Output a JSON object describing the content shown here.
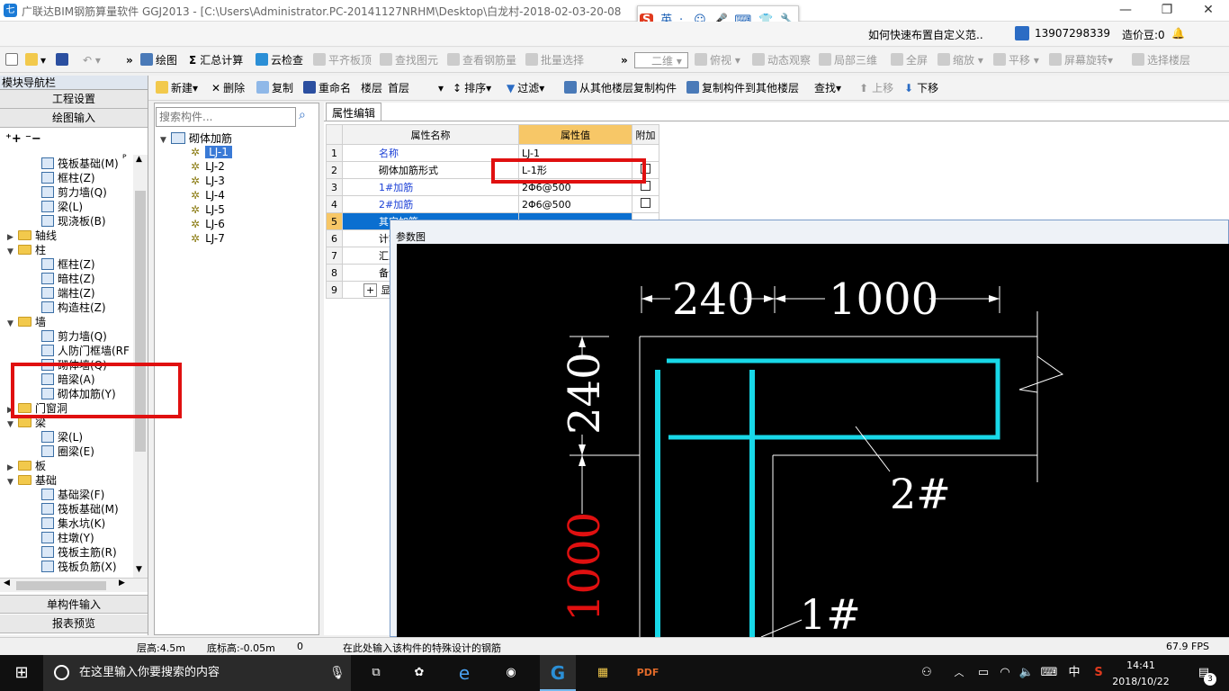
{
  "window": {
    "title": "广联达BIM钢筋算量软件 GGJ2013 - [C:\\Users\\Administrator.PC-20141127NRHM\\Desktop\\白龙村-2018-02-03-20-08",
    "minimize": "—",
    "maximize": "❐",
    "close": "✕"
  },
  "ime": {
    "logo": "S",
    "lang": "英",
    "punct": "·,",
    "items": [
      "☺",
      "🎤",
      "⌨",
      "👕",
      "🔧"
    ]
  },
  "topbar": {
    "question": "如何快速布置自定义范..",
    "phone": "13907298339",
    "price": "造价豆:0"
  },
  "toolbar1": {
    "items": [
      "绘图",
      "汇总计算",
      "云检查",
      "平齐板顶",
      "查找图元",
      "查看钢筋量",
      "批量选择",
      "二维",
      "俯视",
      "动态观察",
      "局部三维",
      "全屏",
      "缩放",
      "平移",
      "屏幕旋转",
      "选择楼层"
    ]
  },
  "toolbar2": {
    "new": "新建",
    "delete": "删除",
    "copy": "复制",
    "rename": "重命名",
    "floor_label": "楼层",
    "floor_value": "首层",
    "sort": "排序",
    "filter": "过滤",
    "copy_from": "从其他楼层复制构件",
    "copy_to": "复制构件到其他楼层",
    "find": "查找",
    "up": "上移",
    "down": "下移"
  },
  "leftpanel": {
    "header": "模块导航栏",
    "pin": "ᴾ",
    "close": "×",
    "engineering": "工程设置",
    "drawing": "绘图输入",
    "single_input": "单构件输入",
    "report": "报表预览",
    "tree": [
      {
        "label": "筏板基础(M)",
        "level": 2
      },
      {
        "label": "框柱(Z)",
        "level": 2
      },
      {
        "label": "剪力墙(Q)",
        "level": 2
      },
      {
        "label": "梁(L)",
        "level": 2
      },
      {
        "label": "现浇板(B)",
        "level": 2
      },
      {
        "label": "轴线",
        "level": 1,
        "exp": "▶"
      },
      {
        "label": "柱",
        "level": 1,
        "exp": "▼"
      },
      {
        "label": "框柱(Z)",
        "level": 2
      },
      {
        "label": "暗柱(Z)",
        "level": 2
      },
      {
        "label": "端柱(Z)",
        "level": 2
      },
      {
        "label": "构造柱(Z)",
        "level": 2
      },
      {
        "label": "墙",
        "level": 1,
        "exp": "▼"
      },
      {
        "label": "剪力墙(Q)",
        "level": 2
      },
      {
        "label": "人防门框墙(RF",
        "level": 2
      },
      {
        "label": "砌体墙(Q)",
        "level": 2
      },
      {
        "label": "暗梁(A)",
        "level": 2
      },
      {
        "label": "砌体加筋(Y)",
        "level": 2
      },
      {
        "label": "门窗洞",
        "level": 1,
        "exp": "▶"
      },
      {
        "label": "梁",
        "level": 1,
        "exp": "▼"
      },
      {
        "label": "梁(L)",
        "level": 2
      },
      {
        "label": "圈梁(E)",
        "level": 2
      },
      {
        "label": "板",
        "level": 1,
        "exp": "▶"
      },
      {
        "label": "基础",
        "level": 1,
        "exp": "▼"
      },
      {
        "label": "基础梁(F)",
        "level": 2
      },
      {
        "label": "筏板基础(M)",
        "level": 2
      },
      {
        "label": "集水坑(K)",
        "level": 2
      },
      {
        "label": "柱墩(Y)",
        "level": 2
      },
      {
        "label": "筏板主筋(R)",
        "level": 2
      },
      {
        "label": "筏板负筋(X)",
        "level": 2
      }
    ]
  },
  "midpanel": {
    "search_placeholder": "搜索构件...",
    "root": "砌体加筋",
    "items": [
      "LJ-1",
      "LJ-2",
      "LJ-3",
      "LJ-4",
      "LJ-5",
      "LJ-6",
      "LJ-7"
    ]
  },
  "props": {
    "tab": "属性编辑",
    "headers": [
      "属性名称",
      "属性值",
      "附加"
    ],
    "rows": [
      {
        "num": "1",
        "name": "名称",
        "value": "LJ-1",
        "blue": true,
        "check": false
      },
      {
        "num": "2",
        "name": "砌体加筋形式",
        "value": "L-1形",
        "blue": false,
        "check": true
      },
      {
        "num": "3",
        "name": "1#加筋",
        "value": "2Φ6@500",
        "blue": true,
        "check": true
      },
      {
        "num": "4",
        "name": "2#加筋",
        "value": "2Φ6@500",
        "blue": true,
        "check": true
      },
      {
        "num": "5",
        "name": "其它加筋",
        "value": "",
        "blue": false,
        "check": false
      },
      {
        "num": "6",
        "name": "计算设置",
        "value": "",
        "blue": false,
        "check": false
      },
      {
        "num": "7",
        "name": "汇总信息",
        "value": "",
        "blue": false,
        "check": false
      },
      {
        "num": "8",
        "name": "备注",
        "value": "",
        "blue": false,
        "check": false
      },
      {
        "num": "9",
        "name": "显示样式",
        "value": "",
        "blue": false,
        "check": false
      }
    ]
  },
  "param": {
    "title": "参数图",
    "dim_top1": "240",
    "dim_top2": "1000",
    "dim_left1": "240",
    "dim_left2": "1000",
    "label2": "2#",
    "label1": "1#"
  },
  "status": {
    "floor_height": "层高:4.5m",
    "bottom_height": "底标高:-0.05m",
    "zero": "0",
    "hint": "在此处输入该构件的特殊设计的钢筋",
    "fps": "67.9 FPS"
  },
  "taskbar": {
    "search": "在这里输入你要搜索的内容",
    "time": "14:41",
    "date": "2018/10/22",
    "lang": "中",
    "notif": "3"
  }
}
